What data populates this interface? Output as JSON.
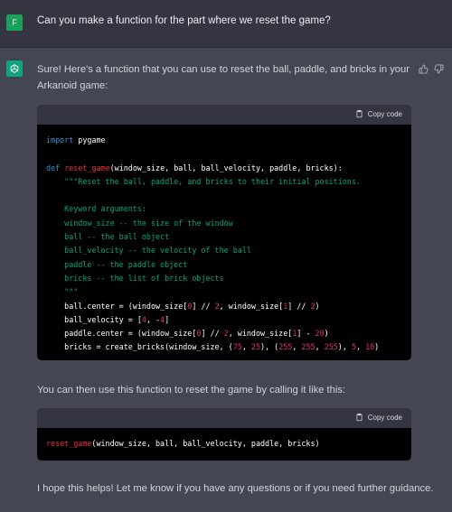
{
  "user": {
    "avatar_letter": "F",
    "message": "Can you make a function for the part where we reset the game?"
  },
  "assistant": {
    "intro_line1": "Sure! Here's a function that you can use to reset the ball, paddle, and bricks in your",
    "intro_line2": "Arkanoid game:",
    "middle_text": "You can then use this function to reset the game by calling it like this:",
    "closing_text": "I hope this helps! Let me know if you have any questions or if you need further guidance."
  },
  "code1": {
    "copy_label": "Copy code",
    "lines": [
      [
        {
          "t": "import",
          "c": "kw"
        },
        {
          "t": " pygame"
        }
      ],
      [],
      [
        {
          "t": "def",
          "c": "kw"
        },
        {
          "t": " "
        },
        {
          "t": "reset_game",
          "c": "fn"
        },
        {
          "t": "(window_size, ball, ball_velocity, paddle, bricks):"
        }
      ],
      [
        {
          "t": "    "
        },
        {
          "t": "\"\"\"Reset the ball, paddle, and bricks to their initial positions.",
          "c": "str"
        }
      ],
      [],
      [
        {
          "t": "    Keyword arguments:",
          "c": "str"
        }
      ],
      [
        {
          "t": "    window_size -- the size of the window",
          "c": "str"
        }
      ],
      [
        {
          "t": "    ball -- the ball object",
          "c": "str"
        }
      ],
      [
        {
          "t": "    ball_velocity -- the velocity of the ball",
          "c": "str"
        }
      ],
      [
        {
          "t": "    paddle -- the paddle object",
          "c": "str"
        }
      ],
      [
        {
          "t": "    bricks -- the list of brick objects",
          "c": "str"
        }
      ],
      [
        {
          "t": "    \"\"\"",
          "c": "str"
        }
      ],
      [
        {
          "t": "    ball.center = (window_size["
        },
        {
          "t": "0",
          "c": "num"
        },
        {
          "t": "] // "
        },
        {
          "t": "2",
          "c": "num"
        },
        {
          "t": ", window_size["
        },
        {
          "t": "1",
          "c": "num"
        },
        {
          "t": "] // "
        },
        {
          "t": "2",
          "c": "num"
        },
        {
          "t": ")"
        }
      ],
      [
        {
          "t": "    ball_velocity = ["
        },
        {
          "t": "4",
          "c": "num"
        },
        {
          "t": ", -"
        },
        {
          "t": "4",
          "c": "num"
        },
        {
          "t": "]"
        }
      ],
      [
        {
          "t": "    paddle.center = (window_size["
        },
        {
          "t": "0",
          "c": "num"
        },
        {
          "t": "] // "
        },
        {
          "t": "2",
          "c": "num"
        },
        {
          "t": ", window_size["
        },
        {
          "t": "1",
          "c": "num"
        },
        {
          "t": "] - "
        },
        {
          "t": "20",
          "c": "num"
        },
        {
          "t": ")"
        }
      ],
      [
        {
          "t": "    bricks = create_bricks(window_size, ("
        },
        {
          "t": "75",
          "c": "num"
        },
        {
          "t": ", "
        },
        {
          "t": "25",
          "c": "num"
        },
        {
          "t": "), ("
        },
        {
          "t": "255",
          "c": "num"
        },
        {
          "t": ", "
        },
        {
          "t": "255",
          "c": "num"
        },
        {
          "t": ", "
        },
        {
          "t": "255",
          "c": "num"
        },
        {
          "t": "), "
        },
        {
          "t": "5",
          "c": "num"
        },
        {
          "t": ", "
        },
        {
          "t": "10",
          "c": "num"
        },
        {
          "t": ")"
        }
      ]
    ]
  },
  "code2": {
    "copy_label": "Copy code",
    "lines": [
      [
        {
          "t": "reset_game",
          "c": "fn"
        },
        {
          "t": "(window_size, ball, ball_velocity, paddle, bricks)"
        }
      ]
    ]
  }
}
